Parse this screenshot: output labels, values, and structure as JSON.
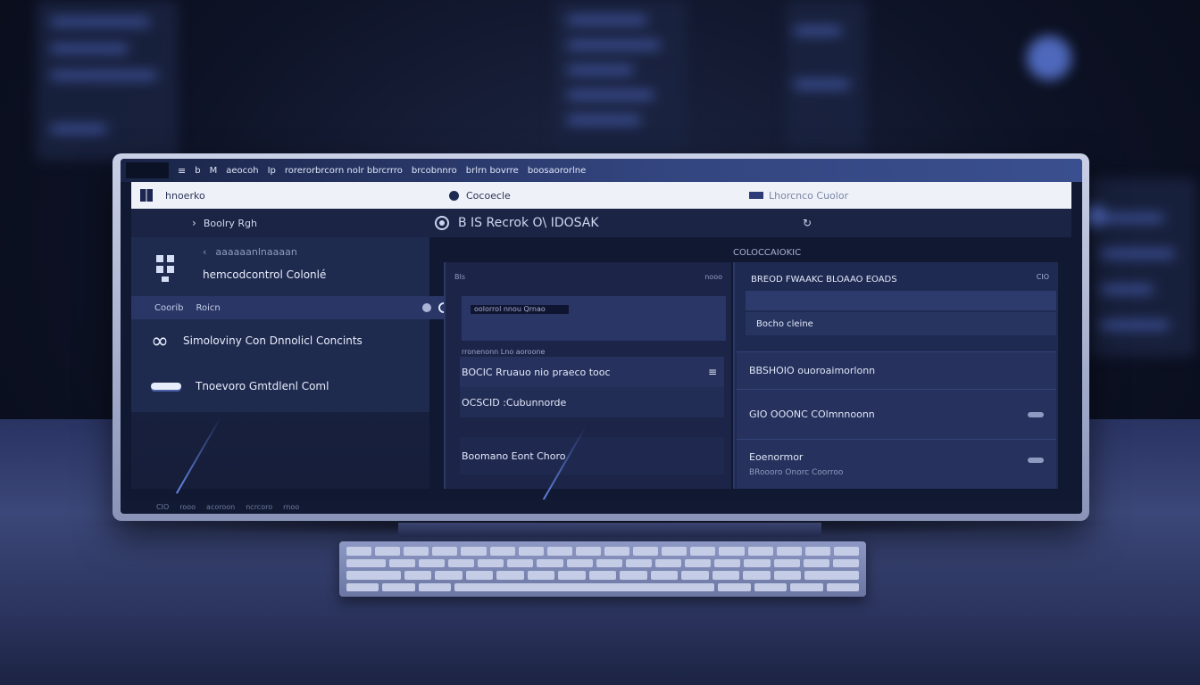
{
  "titlebar": {
    "segments": [
      "b",
      "M",
      "aeocoh",
      "Ip",
      "rorerorbrcorn nolr bbrcrrro",
      "brcobnnro",
      "brlrn bovrre",
      "boosaororlne"
    ]
  },
  "header": {
    "app_name": "hnoerko",
    "center_label": "Cocoecle",
    "right_label": "Lhorcnco Cuolor"
  },
  "toolbar": {
    "left_label": "Boolry Rgh",
    "title": "B   IS Recrok   O\\ IDOSAK"
  },
  "left_panel": {
    "row1_text": "aaaaaanlnaaaan",
    "title": "hemcodcontrol Colonlé",
    "bar_items": [
      "Coorib",
      "Roicn"
    ],
    "item2": "Simoloviny Con Dnnolicl Concints",
    "item3": "Tnoevoro Gmtdlenl Coml"
  },
  "middle_panel": {
    "top_left": "BIs",
    "top_right": "nooo",
    "tag": "oolorrol nnou Qrnao",
    "line": "rronenonn Lno aoroone",
    "row1": "BOCIC Rruauo nio praeco tooc",
    "row2": "OCSCID :Cubunnorde",
    "row3": "Boomano Eont Choro"
  },
  "right_panel": {
    "header": "COLOCCAIOKIC",
    "title": "BREOD FWAAKC BLOAAO EOADS",
    "close": "CIO",
    "sub": "Bocho cleine",
    "row1": "BBSHOIO ouoroaimorlonn",
    "row2": "GIO OOONC COlmnnoonn",
    "row3_title": "Eoenormor",
    "row3_sub": "BRoooro Onorc    Coorroo"
  },
  "statusbar": {
    "items": [
      "CIO",
      "rooo",
      "acoroon",
      "ncrcoro",
      "rnoo"
    ]
  },
  "colors": {
    "accent": "#3a4f8f",
    "panel": "#1f2a52",
    "header_bg": "#eef1f8"
  }
}
